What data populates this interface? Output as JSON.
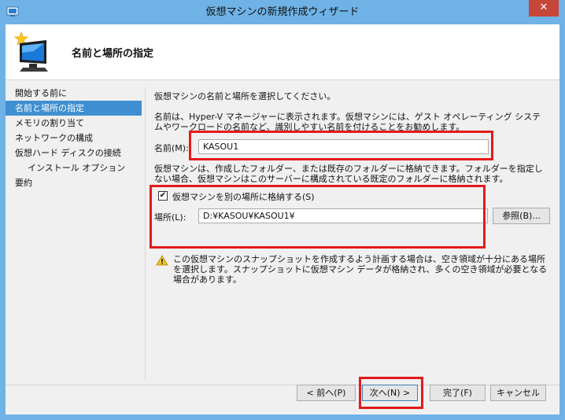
{
  "window": {
    "title": "仮想マシンの新規作成ウィザード",
    "close_glyph": "✕"
  },
  "header": {
    "page_title": "名前と場所の指定"
  },
  "nav": {
    "items": [
      {
        "label": "開始する前に",
        "active": false,
        "sub": false
      },
      {
        "label": "名前と場所の指定",
        "active": true,
        "sub": false
      },
      {
        "label": "メモリの割り当て",
        "active": false,
        "sub": false
      },
      {
        "label": "ネットワークの構成",
        "active": false,
        "sub": false
      },
      {
        "label": "仮想ハード ディスクの接続",
        "active": false,
        "sub": false
      },
      {
        "label": "インストール オプション",
        "active": false,
        "sub": true
      },
      {
        "label": "要約",
        "active": false,
        "sub": false
      }
    ]
  },
  "content": {
    "intro": "仮想マシンの名前と場所を選択してください。",
    "name_help": "名前は、Hyper-V マネージャーに表示されます。仮想マシンには、ゲスト オペレーティング システムやワークロードの名前など、識別しやすい名前を付けることをお勧めします。",
    "name_label": "名前(M):",
    "name_value": "KASOU1",
    "folder_help": "仮想マシンは、作成したフォルダー、または既存のフォルダーに格納できます。フォルダーを指定しない場合、仮想マシンはこのサーバーに構成されている既定のフォルダーに格納されます。",
    "store_checkbox_label": "仮想マシンを別の場所に格納する(S)",
    "store_checked": true,
    "check_glyph": "✔",
    "location_label": "場所(L):",
    "location_value": "D:¥KASOU¥KASOU1¥",
    "browse_label": "参照(B)...",
    "warning": "この仮想マシンのスナップショットを作成するよう計画する場合は、空き領域が十分にある場所を選択します。スナップショットに仮想マシン データが格納され、多くの空き領域が必要となる場合があります。"
  },
  "buttons": {
    "prev": "< 前へ(P)",
    "next": "次へ(N) >",
    "finish": "完了(F)",
    "cancel": "キャンセル"
  },
  "colors": {
    "title_bar": "#6fb2e6",
    "nav_active": "#3f8fd2",
    "highlight": "#e41a1a",
    "close_button": "#c7463a"
  }
}
